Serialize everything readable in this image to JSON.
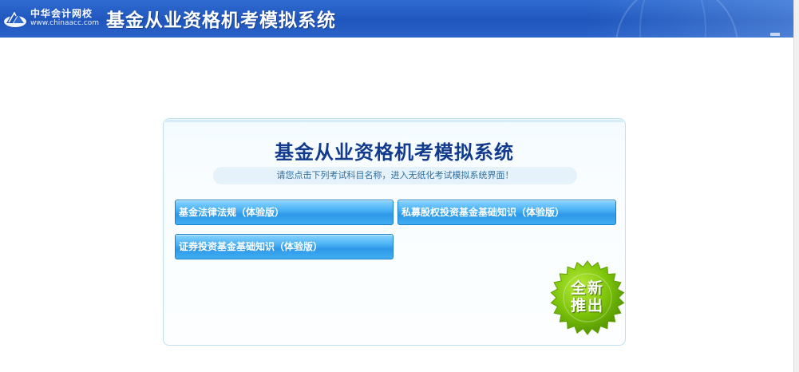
{
  "header": {
    "logo_cn": "中华会计网校",
    "logo_url": "www.chinaacc.com",
    "title": "基金从业资格机考模拟系统"
  },
  "panel": {
    "title": "基金从业资格机考模拟系统",
    "subtitle": "请您点击下列考试科目名称，进入无纸化考试模拟系统界面！",
    "subjects": [
      {
        "label": "基金法律法规（体验版）"
      },
      {
        "label": "私募股权投资基金基础知识（体验版）"
      },
      {
        "label": "证券投资基金基础知识（体验版）"
      }
    ]
  },
  "badge": {
    "line1": "全新",
    "line2": "推出"
  },
  "colors": {
    "header_blue": "#1f56bd",
    "title_blue": "#123a8d",
    "button_blue": "#2c98e8",
    "badge_green": "#6fb800"
  },
  "icons": {
    "logo": "chinaacc-logo-icon",
    "badge": "starburst-badge-icon"
  }
}
